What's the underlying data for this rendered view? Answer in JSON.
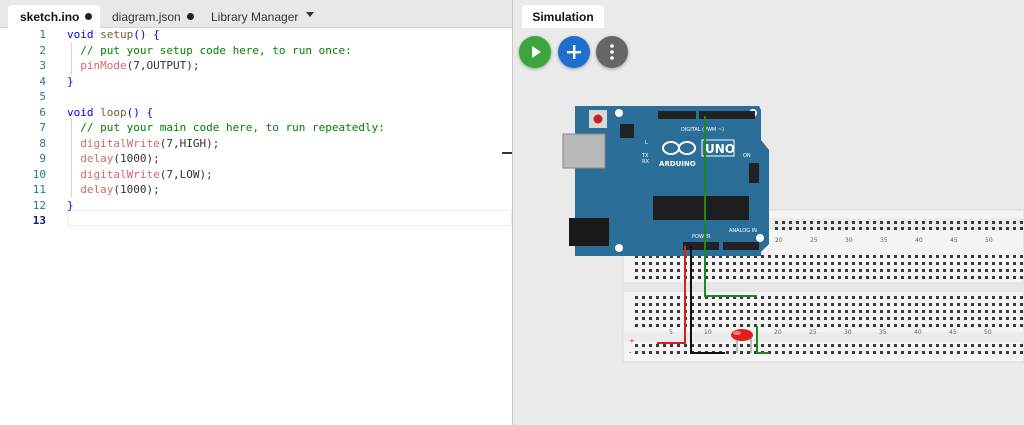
{
  "editor": {
    "tabs": [
      {
        "label": "sketch.ino",
        "modified": true
      },
      {
        "label": "diagram.json",
        "modified": true
      },
      {
        "label": "Library Manager"
      }
    ],
    "line_numbers": [
      "1",
      "2",
      "3",
      "4",
      "5",
      "6",
      "7",
      "8",
      "9",
      "10",
      "11",
      "12",
      "13"
    ],
    "code_lines": [
      [
        {
          "t": "void ",
          "c": "kw"
        },
        {
          "t": "setup",
          "c": "fn"
        },
        {
          "t": "() {",
          "c": "kw"
        }
      ],
      [
        {
          "t": "  // put your setup code here, to run once:",
          "c": "cm"
        }
      ],
      [
        {
          "t": "  pinMode",
          "c": "call"
        },
        {
          "t": "(7,OUTPUT);",
          "c": ""
        }
      ],
      [
        {
          "t": "}",
          "c": "kw"
        }
      ],
      [],
      [
        {
          "t": "void ",
          "c": "kw"
        },
        {
          "t": "loop",
          "c": "fn"
        },
        {
          "t": "() {",
          "c": "kw"
        }
      ],
      [
        {
          "t": "  // put your main code here, to run repeatedly:",
          "c": "cm"
        }
      ],
      [
        {
          "t": "  digitalWrite",
          "c": "call"
        },
        {
          "t": "(7,HIGH);",
          "c": ""
        }
      ],
      [
        {
          "t": "  delay",
          "c": "call"
        },
        {
          "t": "(1000);",
          "c": ""
        }
      ],
      [
        {
          "t": "  digitalWrite",
          "c": "call"
        },
        {
          "t": "(7,LOW);",
          "c": ""
        }
      ],
      [
        {
          "t": "  delay",
          "c": "call"
        },
        {
          "t": "(1000);",
          "c": ""
        }
      ],
      [
        {
          "t": "}",
          "c": "kw"
        }
      ],
      []
    ],
    "current_line": "13"
  },
  "simulation": {
    "tab_label": "Simulation",
    "buttons": [
      {
        "name": "start-simulation-button",
        "icon": "play-icon",
        "color": "#3da53d"
      },
      {
        "name": "add-part-button",
        "icon": "plus-icon",
        "color": "#1e6fcf"
      },
      {
        "name": "more-options-button",
        "icon": "kebab-menu-icon",
        "color": "#666666"
      }
    ],
    "board": {
      "model": "UNO",
      "brand": "ARDUINO",
      "header_digital": "DIGITAL (PWM ~)",
      "header_power": "POWER",
      "header_analog": "ANALOG IN",
      "on_label": "ON",
      "tx_label": "TX",
      "rx_label": "RX",
      "l_label": "L",
      "color": "#2b6f99"
    },
    "breadboard": {
      "column_numbers": [
        "20",
        "25",
        "30",
        "35",
        "40",
        "45",
        "50"
      ],
      "lower_numbers": [
        "5",
        "10",
        "15",
        "20",
        "25",
        "30",
        "35",
        "40",
        "45",
        "50"
      ]
    },
    "wire_colors": {
      "signal": "#1a8a1a",
      "power": "#d32020",
      "ground": "#111111"
    },
    "led_color": "#e02020"
  }
}
